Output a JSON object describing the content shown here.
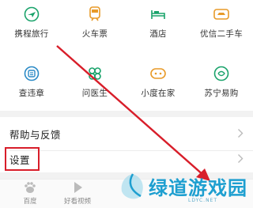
{
  "services_row1": [
    {
      "label": "携程旅行",
      "icon": "plane-icon"
    },
    {
      "label": "火车票",
      "icon": "train-icon"
    },
    {
      "label": "酒店",
      "icon": "bed-icon"
    },
    {
      "label": "优信二手车",
      "icon": "car-icon"
    }
  ],
  "services_row2": [
    {
      "label": "查违章",
      "icon": "traffic-ticket-icon"
    },
    {
      "label": "问医生",
      "icon": "doctor-icon"
    },
    {
      "label": "小度在家",
      "icon": "speaker-icon"
    },
    {
      "label": "苏宁易购",
      "icon": "shopping-icon"
    }
  ],
  "menu": {
    "help_label": "帮助与反馈",
    "settings_label": "设置"
  },
  "tabbar": {
    "baidu_label": "百度",
    "video_label": "好看视频"
  },
  "watermark": {
    "title": "绿道游戏园",
    "subtitle": "LDYC.NET"
  },
  "colors": {
    "icon_green": "#1aa36b",
    "icon_orange": "#e89a28",
    "icon_blue": "#2b8ac6",
    "annotation_red": "#d81e2a",
    "watermark_blue": "#1e9fd0"
  }
}
